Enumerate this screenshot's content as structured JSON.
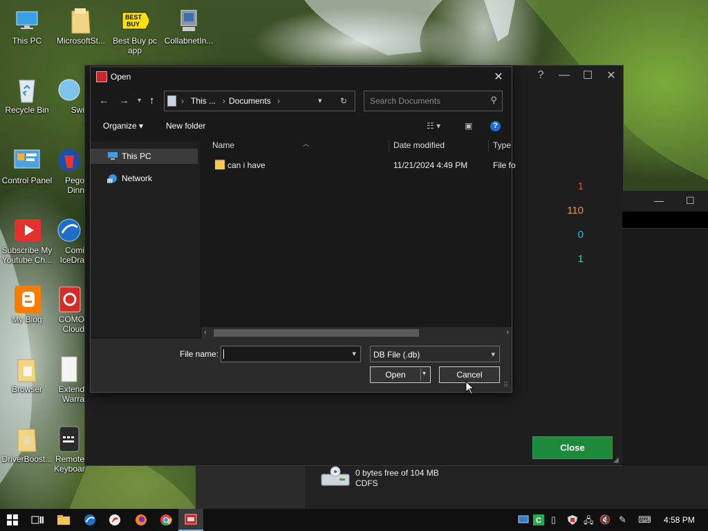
{
  "desktop": {
    "icons": [
      {
        "label": "This PC",
        "icon": "this-pc-icon"
      },
      {
        "label": "MicrosoftSt...",
        "icon": "microsoft-store-icon"
      },
      {
        "label": "Best Buy pc app",
        "icon": "best-buy-icon"
      },
      {
        "label": "CollabnetIn...",
        "icon": "collabnet-icon"
      },
      {
        "label": "Recycle Bin",
        "icon": "recycle-bin-icon"
      },
      {
        "label": "Swi",
        "icon": "swi-icon"
      },
      {
        "label": "Control Panel",
        "icon": "control-panel-icon"
      },
      {
        "label": "Pego Dinn",
        "icon": "pego-icon"
      },
      {
        "label": "Subscribe My Youtube Ch...",
        "icon": "youtube-icon"
      },
      {
        "label": "Comi IceDra",
        "icon": "icedragon-icon"
      },
      {
        "label": "My Blog",
        "icon": "blogger-icon"
      },
      {
        "label": "COMO Cloud",
        "icon": "comodo-cloud-icon"
      },
      {
        "label": "Browser",
        "icon": "folder-icon"
      },
      {
        "label": "Extend Warra",
        "icon": "document-icon"
      },
      {
        "label": "DriverBoost...",
        "icon": "folder-icon"
      },
      {
        "label": "Remote Keyboard ...",
        "icon": "keyboard-icon"
      }
    ]
  },
  "background_app": {
    "values": [
      "1",
      "110",
      "0",
      "1"
    ],
    "value_colors": [
      "#e0582e",
      "#e0962e",
      "#2eb6e0",
      "#3ed18a"
    ],
    "close_label": "Close",
    "close_color": "#1c8a3a",
    "drive_free": "0 bytes free of 104 MB",
    "drive_fs": "CDFS"
  },
  "dialog": {
    "title": "Open",
    "breadcrumb": [
      "This ...",
      "Documents"
    ],
    "search_placeholder": "Search Documents",
    "toolbar": {
      "organize": "Organize ▾",
      "new_folder": "New folder"
    },
    "nav_items": [
      {
        "label": "This PC",
        "selected": true
      },
      {
        "label": "Network",
        "selected": false
      }
    ],
    "columns": [
      "Name",
      "Date modified",
      "Type"
    ],
    "files": [
      {
        "name": "can i have",
        "date": "11/21/2024 4:49 PM",
        "type": "File fo"
      }
    ],
    "file_name_label": "File name:",
    "file_name_value": "",
    "file_type": "DB File (.db)",
    "open_label": "Open",
    "cancel_label": "Cancel"
  },
  "taskbar": {
    "time": "4:58 PM",
    "apps": [
      "start-icon",
      "task-view-icon",
      "file-explorer-icon",
      "icedragon-icon",
      "dragon-icon",
      "firefox-icon",
      "chrome-icon",
      "db-app-icon"
    ]
  }
}
